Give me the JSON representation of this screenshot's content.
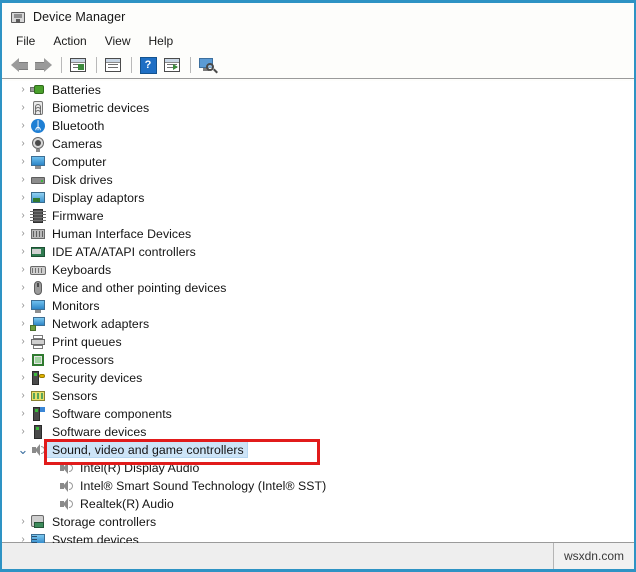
{
  "window": {
    "title": "Device Manager",
    "title_icon": "device-manager-icon",
    "accent_border": "#2e93c4"
  },
  "menu": {
    "items": [
      {
        "label": "File"
      },
      {
        "label": "Action"
      },
      {
        "label": "View"
      },
      {
        "label": "Help"
      }
    ]
  },
  "toolbar": {
    "items": [
      {
        "name": "back-button",
        "icon": "back-arrow-icon"
      },
      {
        "name": "forward-button",
        "icon": "forward-arrow-icon"
      },
      {
        "name": "separator-1",
        "icon": "separator"
      },
      {
        "name": "show-hidden-devices-button",
        "icon": "window-list-icon"
      },
      {
        "name": "properties-button",
        "icon": "properties-window-icon"
      },
      {
        "name": "separator-2",
        "icon": "separator"
      },
      {
        "name": "help-button",
        "icon": "question-mark-icon",
        "label": "?"
      },
      {
        "name": "update-driver-button",
        "icon": "window-play-icon"
      },
      {
        "name": "separator-3",
        "icon": "separator"
      },
      {
        "name": "scan-hardware-changes-button",
        "icon": "scan-monitor-icon"
      }
    ]
  },
  "tree": {
    "items": [
      {
        "label": "Batteries",
        "icon": "battery-icon",
        "state": "collapsed",
        "level": 0
      },
      {
        "label": "Biometric devices",
        "icon": "fingerprint-icon",
        "state": "collapsed",
        "level": 0
      },
      {
        "label": "Bluetooth",
        "icon": "bluetooth-icon",
        "state": "collapsed",
        "level": 0
      },
      {
        "label": "Cameras",
        "icon": "camera-icon",
        "state": "collapsed",
        "level": 0
      },
      {
        "label": "Computer",
        "icon": "monitor-icon",
        "state": "collapsed",
        "level": 0
      },
      {
        "label": "Disk drives",
        "icon": "disk-drive-icon",
        "state": "collapsed",
        "level": 0
      },
      {
        "label": "Display adaptors",
        "icon": "display-adapter-icon",
        "state": "collapsed",
        "level": 0
      },
      {
        "label": "Firmware",
        "icon": "firmware-chip-icon",
        "state": "collapsed",
        "level": 0
      },
      {
        "label": "Human Interface Devices",
        "icon": "hid-icon",
        "state": "collapsed",
        "level": 0
      },
      {
        "label": "IDE ATA/ATAPI controllers",
        "icon": "ide-controller-icon",
        "state": "collapsed",
        "level": 0
      },
      {
        "label": "Keyboards",
        "icon": "keyboard-icon",
        "state": "collapsed",
        "level": 0
      },
      {
        "label": "Mice and other pointing devices",
        "icon": "mouse-icon",
        "state": "collapsed",
        "level": 0
      },
      {
        "label": "Monitors",
        "icon": "monitor-icon",
        "state": "collapsed",
        "level": 0
      },
      {
        "label": "Network adapters",
        "icon": "network-adapter-icon",
        "state": "collapsed",
        "level": 0
      },
      {
        "label": "Print queues",
        "icon": "printer-icon",
        "state": "collapsed",
        "level": 0
      },
      {
        "label": "Processors",
        "icon": "processor-icon",
        "state": "collapsed",
        "level": 0
      },
      {
        "label": "Security devices",
        "icon": "security-device-icon",
        "state": "collapsed",
        "level": 0
      },
      {
        "label": "Sensors",
        "icon": "sensor-icon",
        "state": "collapsed",
        "level": 0
      },
      {
        "label": "Software components",
        "icon": "software-component-icon",
        "state": "collapsed",
        "level": 0
      },
      {
        "label": "Software devices",
        "icon": "software-device-icon",
        "state": "collapsed",
        "level": 0
      },
      {
        "label": "Sound, video and game controllers",
        "icon": "speaker-icon",
        "state": "expanded",
        "level": 0,
        "selected": true
      },
      {
        "label": "Intel(R) Display Audio",
        "icon": "speaker-icon",
        "state": "leaf",
        "level": 1
      },
      {
        "label": "Intel® Smart Sound Technology (Intel® SST)",
        "icon": "speaker-icon",
        "state": "leaf",
        "level": 1
      },
      {
        "label": "Realtek(R) Audio",
        "icon": "speaker-icon",
        "state": "leaf",
        "level": 1
      },
      {
        "label": "Storage controllers",
        "icon": "storage-controller-icon",
        "state": "collapsed",
        "level": 0
      },
      {
        "label": "System devices",
        "icon": "system-device-icon",
        "state": "collapsed",
        "level": 0
      }
    ],
    "chevron_collapsed": "›",
    "chevron_expanded": "⌄",
    "selection_color": "#cde4f7"
  },
  "annotation": {
    "highlight_color": "#e11b1b",
    "target_label": "Sound, video and game controllers"
  },
  "statusbar": {
    "watermark": "wsxdn.com"
  }
}
